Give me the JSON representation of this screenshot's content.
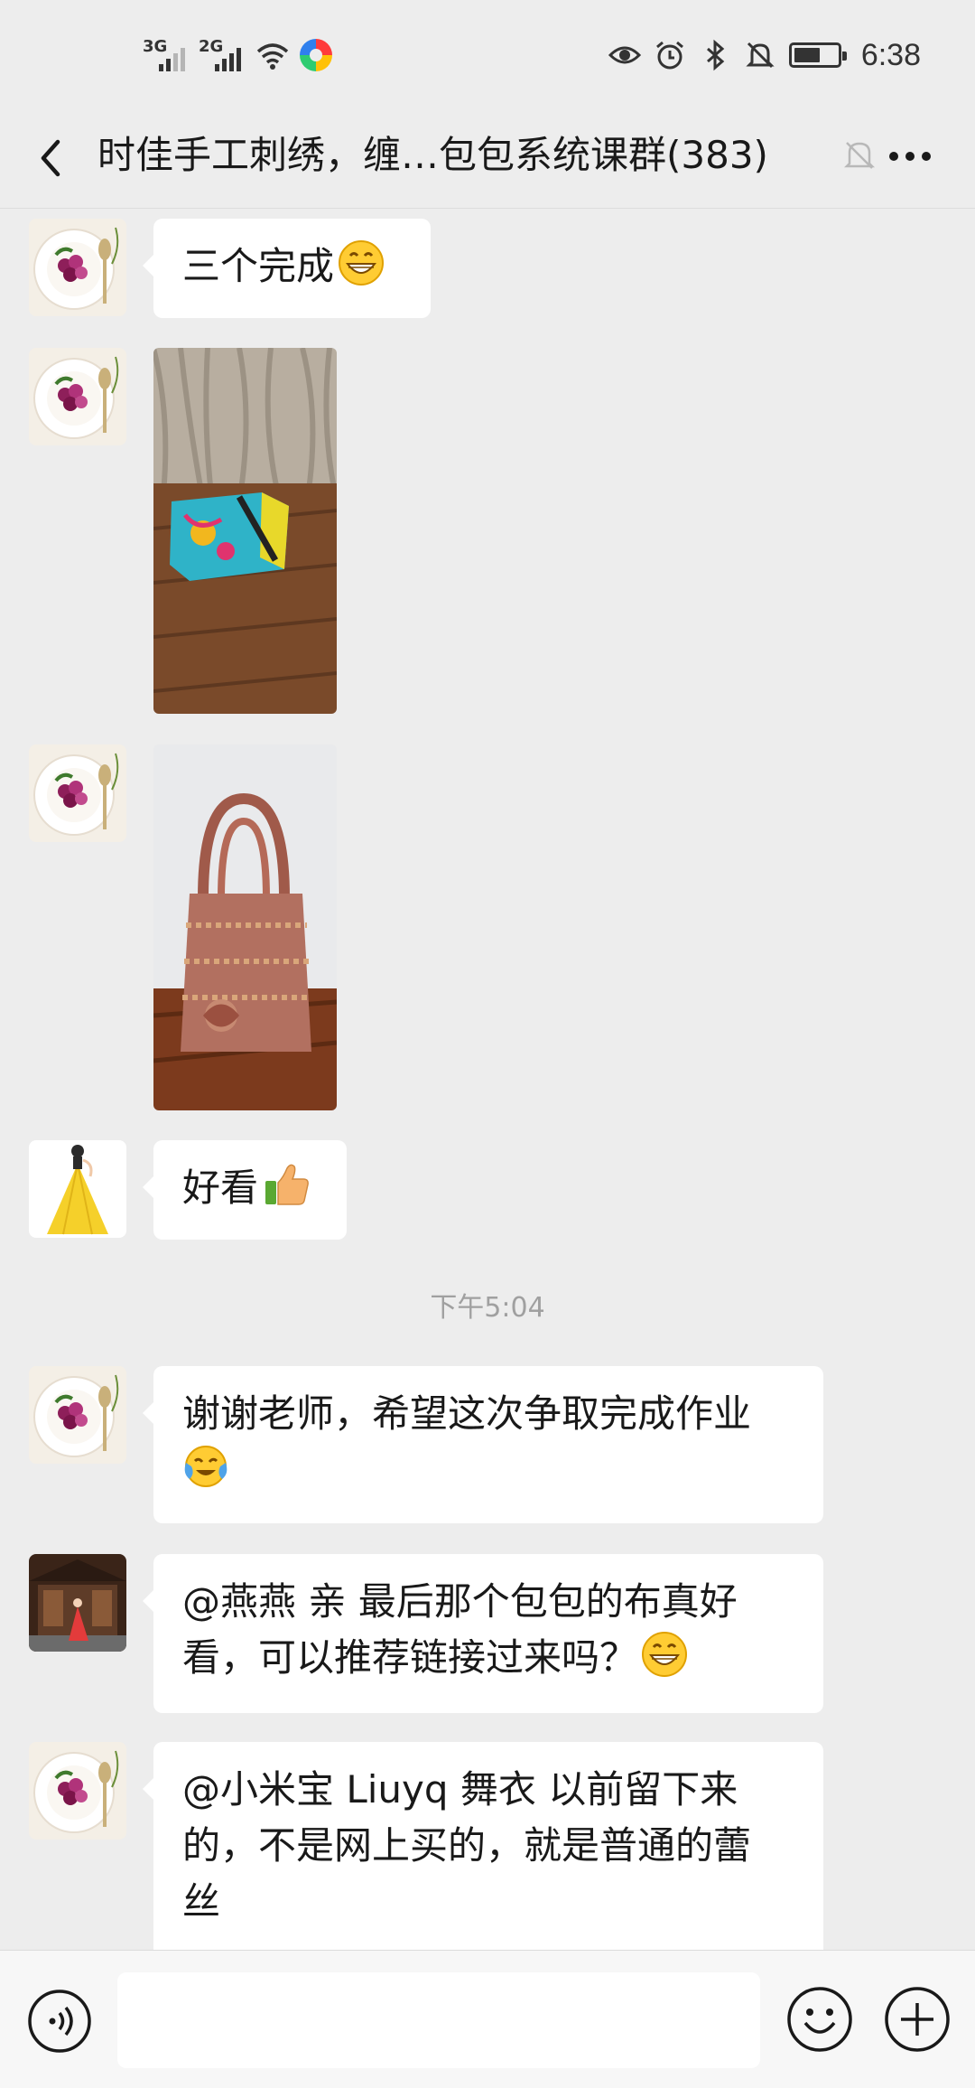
{
  "status_bar": {
    "signal1_label": "3G",
    "signal2_label": "2G",
    "time": "6:38"
  },
  "header": {
    "title": "时佳手工刺绣，缠…包包系统课群(383)",
    "icons": [
      "back-icon",
      "mute-bell-icon",
      "more-icon"
    ]
  },
  "messages": [
    {
      "type": "text",
      "avatar": "plate-flower-avatar",
      "text": "三个完成",
      "emoji": "grin"
    },
    {
      "type": "image",
      "avatar": "plate-flower-avatar",
      "subject": "bag-photo-teal"
    },
    {
      "type": "image",
      "avatar": "plate-flower-avatar",
      "subject": "bag-photo-lace"
    },
    {
      "type": "text",
      "avatar": "yellow-dress-avatar",
      "text": "好看",
      "emoji": "thumbs-up"
    },
    {
      "type": "timestamp",
      "text": "下午5:04"
    },
    {
      "type": "text",
      "avatar": "plate-flower-avatar",
      "line1": "谢谢老师，希望这次争取完成作业",
      "emoji": "tears-of-joy"
    },
    {
      "type": "text",
      "avatar": "courtyard-avatar",
      "line1": "@燕燕  亲 最后那个包包的布真好",
      "line2": "看，可以推荐链接过来吗？",
      "emoji": "grin"
    },
    {
      "type": "text",
      "avatar": "plate-flower-avatar",
      "line1": "@小米宝 Liuyq 舞衣  以前留下来",
      "line2": "的，不是网上买的，就是普通的蕾",
      "line3": "丝"
    }
  ],
  "input_bar": {
    "text_value": "",
    "icons": [
      "voice-icon",
      "emoji-icon",
      "plus-icon"
    ]
  },
  "colors": {
    "background": "#ededed",
    "bubble": "#ffffff",
    "text": "#191919",
    "timestamp": "#a0a0a0"
  }
}
